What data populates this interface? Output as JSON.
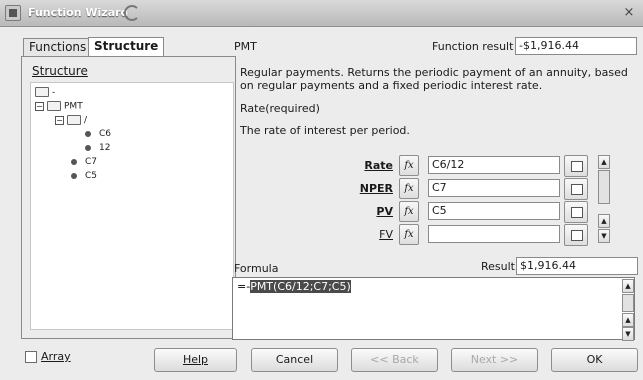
{
  "window": {
    "title": "Function Wizard",
    "close_glyph": "×"
  },
  "tabs": [
    {
      "label": "Functions"
    },
    {
      "label": "Structure"
    }
  ],
  "structure_label": "Structure",
  "tree": [
    {
      "label": "-"
    },
    {
      "label": "PMT"
    },
    {
      "label": "/"
    },
    {
      "label": "C6"
    },
    {
      "label": "12"
    },
    {
      "label": "C7"
    },
    {
      "label": "C5"
    }
  ],
  "function": {
    "name": "PMT",
    "result_label": "Function result",
    "result_value": "-$1,916.44",
    "description": "Regular payments. Returns the periodic payment of an annuity, based on regular payments and a fixed periodic interest rate.",
    "current_arg": "Rate(required)",
    "current_arg_desc": "The rate of interest per period."
  },
  "args": [
    {
      "label": "Rate",
      "value": "C6/12"
    },
    {
      "label": "NPER",
      "value": "C7"
    },
    {
      "label": "PV",
      "value": "C5"
    },
    {
      "label": "FV",
      "value": ""
    }
  ],
  "fx_glyph": "fx",
  "formula": {
    "label": "Formula",
    "result_label": "Result",
    "result_value": "$1,916.44",
    "text_eq": "=-",
    "text_selected": "PMT(C6/12;C7;C5)"
  },
  "buttons": {
    "array": "Array",
    "help": "Help",
    "cancel": "Cancel",
    "back": "<< Back",
    "next": "Next >>",
    "ok": "OK"
  }
}
